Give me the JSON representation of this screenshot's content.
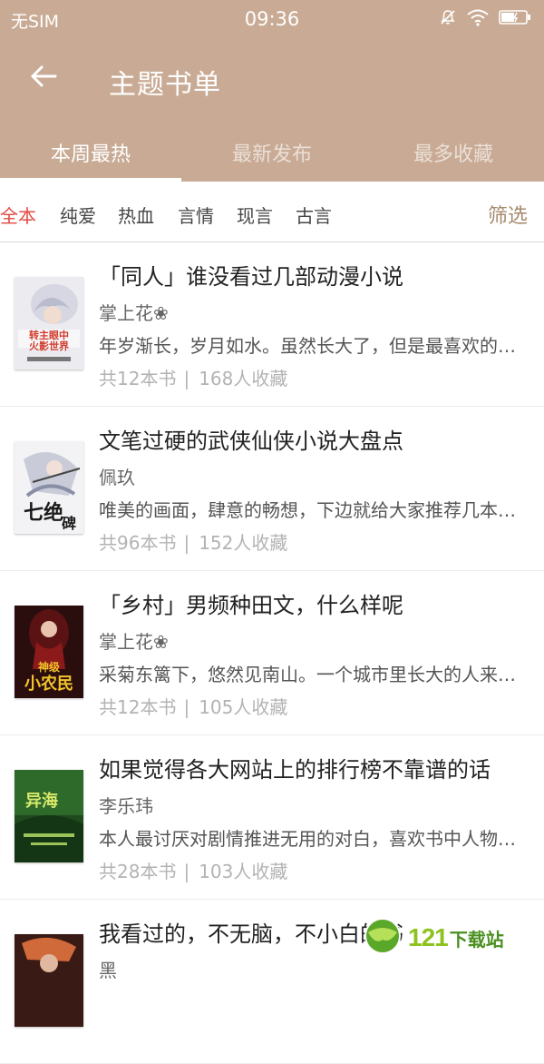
{
  "status_bar": {
    "carrier": "无SIM",
    "time": "09:36",
    "icons": [
      "mute-icon",
      "wifi-icon",
      "battery-icon"
    ]
  },
  "header": {
    "title": "主题书单",
    "back_icon": "arrow-left-icon"
  },
  "tabs": [
    {
      "label": "本周最热",
      "active": true
    },
    {
      "label": "最新发布",
      "active": false
    },
    {
      "label": "最多收藏",
      "active": false
    }
  ],
  "filters": {
    "items": [
      "全本",
      "纯爱",
      "热血",
      "言情",
      "现言",
      "古言"
    ],
    "active": "全本",
    "filter_button": "筛选"
  },
  "books": [
    {
      "title": "「同人」谁没看过几部动漫小说",
      "author": "掌上花❀",
      "desc": "年岁渐长，岁月如水。虽然长大了，但是最喜欢的还是动漫",
      "count": "共12本书",
      "favorites": "168人收藏"
    },
    {
      "title": "文笔过硬的武侠仙侠小说大盘点",
      "author": "佩玖",
      "desc": "唯美的画面，肆意的畅想，下边就给大家推荐几本好书",
      "count": "共96本书",
      "favorites": "152人收藏"
    },
    {
      "title": "「乡村」男频种田文，什么样呢",
      "author": "掌上花❀",
      "desc": "采菊东篱下，悠然见南山。一个城市里长大的人来到乡村",
      "count": "共12本书",
      "favorites": "105人收藏"
    },
    {
      "title": "如果觉得各大网站上的排行榜不靠谱的话",
      "author": "李乐玮",
      "desc": "本人最讨厌对剧情推进无用的对白，喜欢书中人物的成长",
      "count": "共28本书",
      "favorites": "103人收藏"
    },
    {
      "title": "我看过的，不无脑，不小白的书",
      "author": "黑",
      "desc": "",
      "count": "",
      "favorites": ""
    }
  ],
  "covers": [
    {
      "text": "转主眼中火影世界",
      "bg": "#e8e8ee",
      "accent": "#d23a2a"
    },
    {
      "text": "七绝碑",
      "bg": "#f2f2f4",
      "accent": "#1a1a1a"
    },
    {
      "text": "神级小农民",
      "bg": "#2a0e0e",
      "accent": "#f2c32b"
    },
    {
      "text": "异海",
      "bg": "#1f4a1e",
      "accent": "#d8e86a"
    },
    {
      "text": "",
      "bg": "#3a1a14",
      "accent": "#d06a3a"
    }
  ],
  "watermark": {
    "brand": "121",
    "site": "下载站",
    "url": "121down.com"
  }
}
